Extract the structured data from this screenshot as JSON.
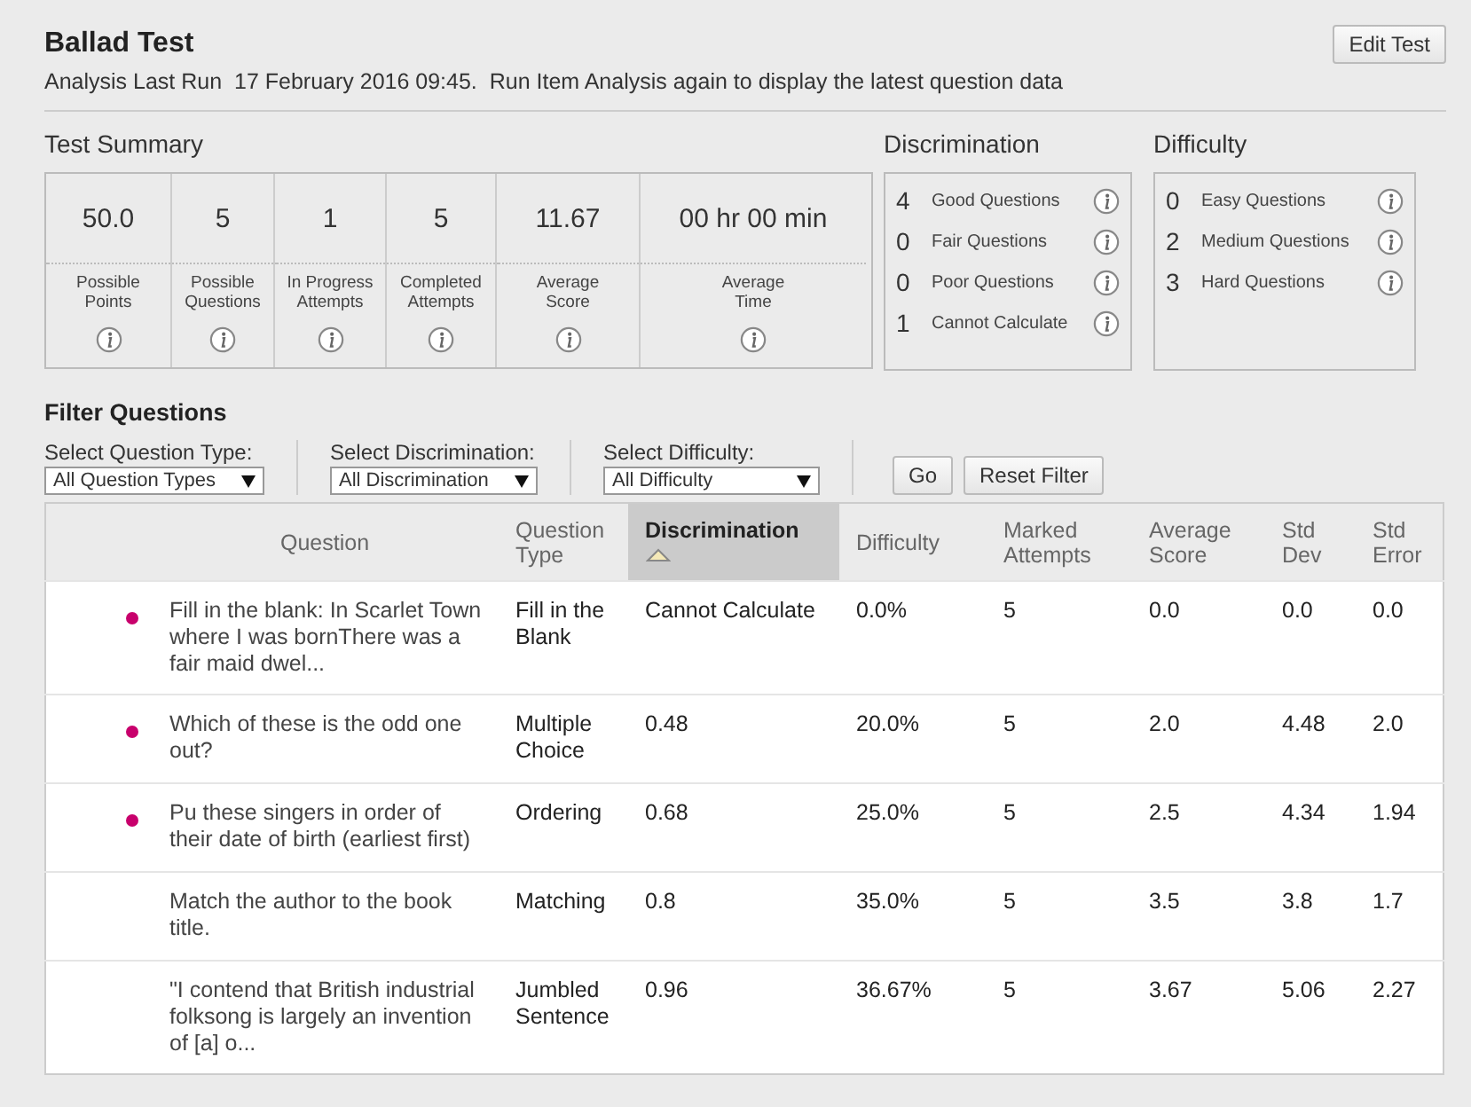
{
  "header": {
    "title": "Ballad Test",
    "subtitle": "Analysis Last Run  17 February 2016 09:45.  Run Item Analysis again to display the latest question data",
    "edit_button": "Edit Test"
  },
  "summary": {
    "title": "Test Summary",
    "cells": [
      {
        "value": "50.0",
        "label": "Possible Points"
      },
      {
        "value": "5",
        "label": "Possible Questions"
      },
      {
        "value": "1",
        "label": "In Progress Attempts"
      },
      {
        "value": "5",
        "label": "Completed Attempts"
      },
      {
        "value": "11.67",
        "label": "Average Score"
      },
      {
        "value": "00 hr 00 min",
        "label": "Average Time"
      }
    ]
  },
  "discrimination": {
    "title": "Discrimination",
    "items": [
      {
        "count": "4",
        "label": "Good Questions"
      },
      {
        "count": "0",
        "label": "Fair Questions"
      },
      {
        "count": "0",
        "label": "Poor Questions"
      },
      {
        "count": "1",
        "label": "Cannot Calculate"
      }
    ]
  },
  "difficulty": {
    "title": "Difficulty",
    "items": [
      {
        "count": "0",
        "label": "Easy Questions"
      },
      {
        "count": "2",
        "label": "Medium Questions"
      },
      {
        "count": "3",
        "label": "Hard Questions"
      }
    ]
  },
  "filter": {
    "title": "Filter Questions",
    "selects": [
      {
        "label": "Select Question Type:",
        "value": "All Question Types"
      },
      {
        "label": "Select Discrimination:",
        "value": "All Discrimination"
      },
      {
        "label": "Select Difficulty:",
        "value": "All Difficulty"
      }
    ],
    "buttons": [
      "Go",
      "Reset Filter"
    ]
  },
  "table": {
    "columns": [
      {
        "label": "Question",
        "selected": false
      },
      {
        "label": "Question Type",
        "selected": false
      },
      {
        "label": "Discrimination",
        "selected": true
      },
      {
        "label": "Difficulty",
        "selected": false
      },
      {
        "label": "Marked Attempts",
        "selected": false
      },
      {
        "label": "Average Score",
        "selected": false
      },
      {
        "label": "Std Dev",
        "selected": false
      },
      {
        "label": "Std Error",
        "selected": false
      }
    ],
    "rows": [
      {
        "flagged": true,
        "cells": [
          "Fill in the blank: In Scarlet Town where I was bornThere was a fair maid dwel...",
          "Fill in the Blank",
          "Cannot Calculate",
          "0.0%",
          "5",
          "0.0",
          "0.0",
          "0.0"
        ]
      },
      {
        "flagged": true,
        "cells": [
          "Which of these is the odd one out?",
          "Multiple Choice",
          "0.48",
          "20.0%",
          "5",
          "2.0",
          "4.48",
          "2.0"
        ]
      },
      {
        "flagged": true,
        "cells": [
          "Pu these singers in order of their date of birth (earliest first)",
          "Ordering",
          "0.68",
          "25.0%",
          "5",
          "2.5",
          "4.34",
          "1.94"
        ]
      },
      {
        "flagged": false,
        "cells": [
          "Match the author to the book title.",
          "Matching",
          "0.8",
          "35.0%",
          "5",
          "3.5",
          "3.8",
          "1.7"
        ]
      },
      {
        "flagged": false,
        "cells": [
          "\"I contend that British industrial folksong is largely an invention of [a] o...",
          "Jumbled Sentence",
          "0.96",
          "36.67%",
          "5",
          "3.67",
          "5.06",
          "2.27"
        ]
      }
    ]
  }
}
